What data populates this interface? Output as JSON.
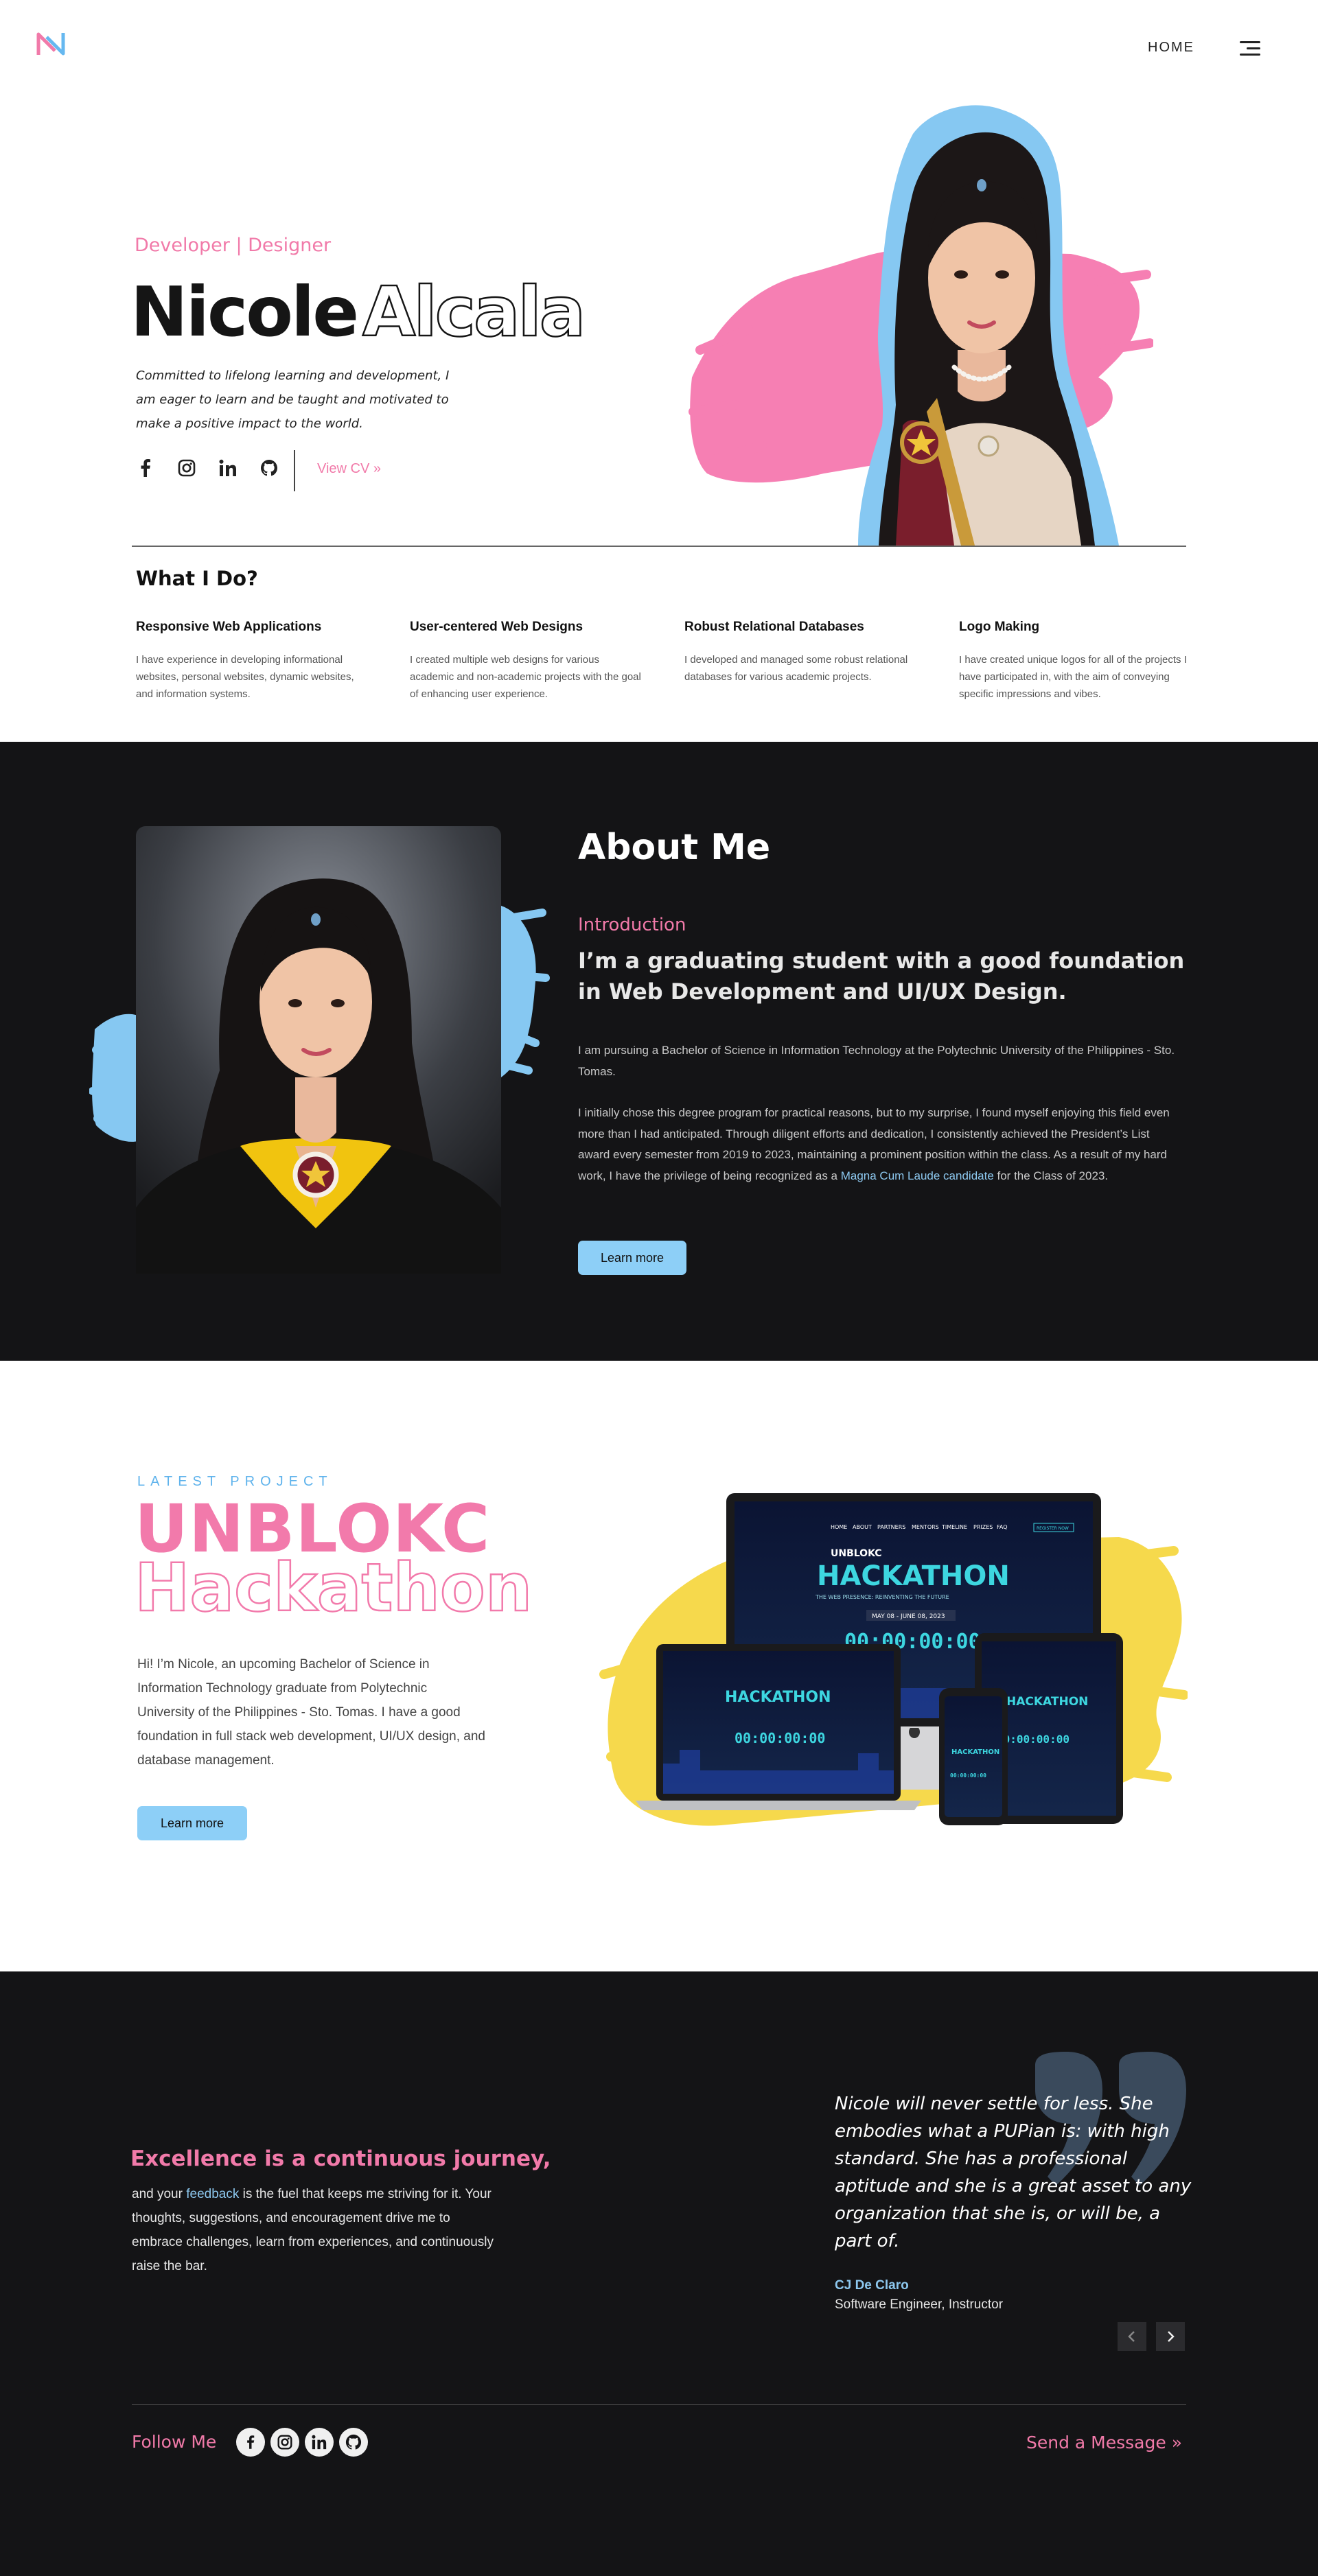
{
  "header": {
    "logo_icon": "n-monogram-logo-icon",
    "nav_home": "HOME",
    "menu_icon": "hamburger-menu-icon"
  },
  "hero": {
    "tagline": "Developer | Designer",
    "first_name": "Nicole",
    "last_name": "Alcala",
    "description": "Committed to lifelong learning and development, I am eager to learn and be taught and motivated to make a positive impact to the world.",
    "socials": [
      "facebook-icon",
      "instagram-icon",
      "linkedin-icon",
      "github-icon"
    ],
    "cv_label": "View CV",
    "cv_chevron": "»"
  },
  "what_i_do": {
    "title": "What I Do?",
    "services": [
      {
        "title": "Responsive Web Applications",
        "text": "I have experience in developing informational websites, personal websites, dynamic websites, and information systems."
      },
      {
        "title": "User-centered Web Designs",
        "text": "I created multiple web designs for various academic and non-academic projects with the goal of enhancing user experience."
      },
      {
        "title": "Robust Relational Databases",
        "text": "I developed and managed some robust relational databases for various academic projects."
      },
      {
        "title": "Logo Making",
        "text": "I have created unique logos for all of the projects I have participated in, with the aim of conveying specific impressions and vibes."
      }
    ]
  },
  "about": {
    "title": "About Me",
    "subtitle": "Introduction",
    "headline": "I’m a graduating student with a good foundation in Web Development and UI/UX Design.",
    "para1": "I am pursuing a Bachelor of Science in Information Technology at the Polytechnic University of the Philippines - Sto. Tomas.",
    "para2_before": "I initially chose this degree program for practical reasons, but to my surprise, I found myself enjoying this field even more than I had anticipated. Through diligent efforts and dedication, I consistently achieved the President’s List award every semester from 2019 to 2023, maintaining a prominent position within the class. As a result of my hard work, I have the privilege of being recognized as a ",
    "para2_highlight": "Magna Cum Laude candidate",
    "para2_after": " for the Class of 2023.",
    "button": "Learn more"
  },
  "project": {
    "eyebrow": "LATEST PROJECT",
    "title_line1": "UNBLOKC",
    "title_line2": "Hackathon",
    "description": "Hi! I’m Nicole, an upcoming Bachelor of Science in Information Technology graduate from Polytechnic University of the Philippines - Sto. Tomas. I have a good foundation in full stack web development, UI/UX design, and database management.",
    "button": "Learn more",
    "mockup": {
      "nav": [
        "HOME",
        "ABOUT",
        "PARTNERS",
        "MENTORS",
        "TIMELINE",
        "PRIZES",
        "FAQ"
      ],
      "register": "REGISTER NOW",
      "brand": "UNBLOKC",
      "headline": "HACKATHON",
      "tagline": "THE WEB PRESENCE: REINVENTING THE FUTURE",
      "dates": "MAY 08 - JUNE 08, 2023",
      "countdown": "00:00:00:00"
    }
  },
  "testimonial": {
    "left_title": "Excellence is a continuous journey,",
    "left_before": "and your ",
    "left_highlight": "feedback",
    "left_after": " is the fuel that keeps me striving for it. Your thoughts, suggestions, and encouragement drive me to embrace challenges, learn from experiences, and continuously raise the bar.",
    "quote": "Nicole will never settle for less. She embodies what a PUPian is: with high standard. She has a professional aptitude and she is a great asset to any organization that she is, or will be, a part of.",
    "author": "CJ De Claro",
    "role": "Software Engineer, Instructor",
    "prev_icon": "chevron-left-icon",
    "next_icon": "chevron-right-icon"
  },
  "footer": {
    "follow": "Follow Me",
    "socials": [
      "facebook-icon",
      "instagram-icon",
      "linkedin-icon",
      "github-icon"
    ],
    "send": "Send a Message",
    "send_chevron": "»"
  },
  "colors": {
    "pink": "#f17aa9",
    "blue": "#8dcff7",
    "dark": "#141416",
    "yellow": "#f6d94c"
  }
}
